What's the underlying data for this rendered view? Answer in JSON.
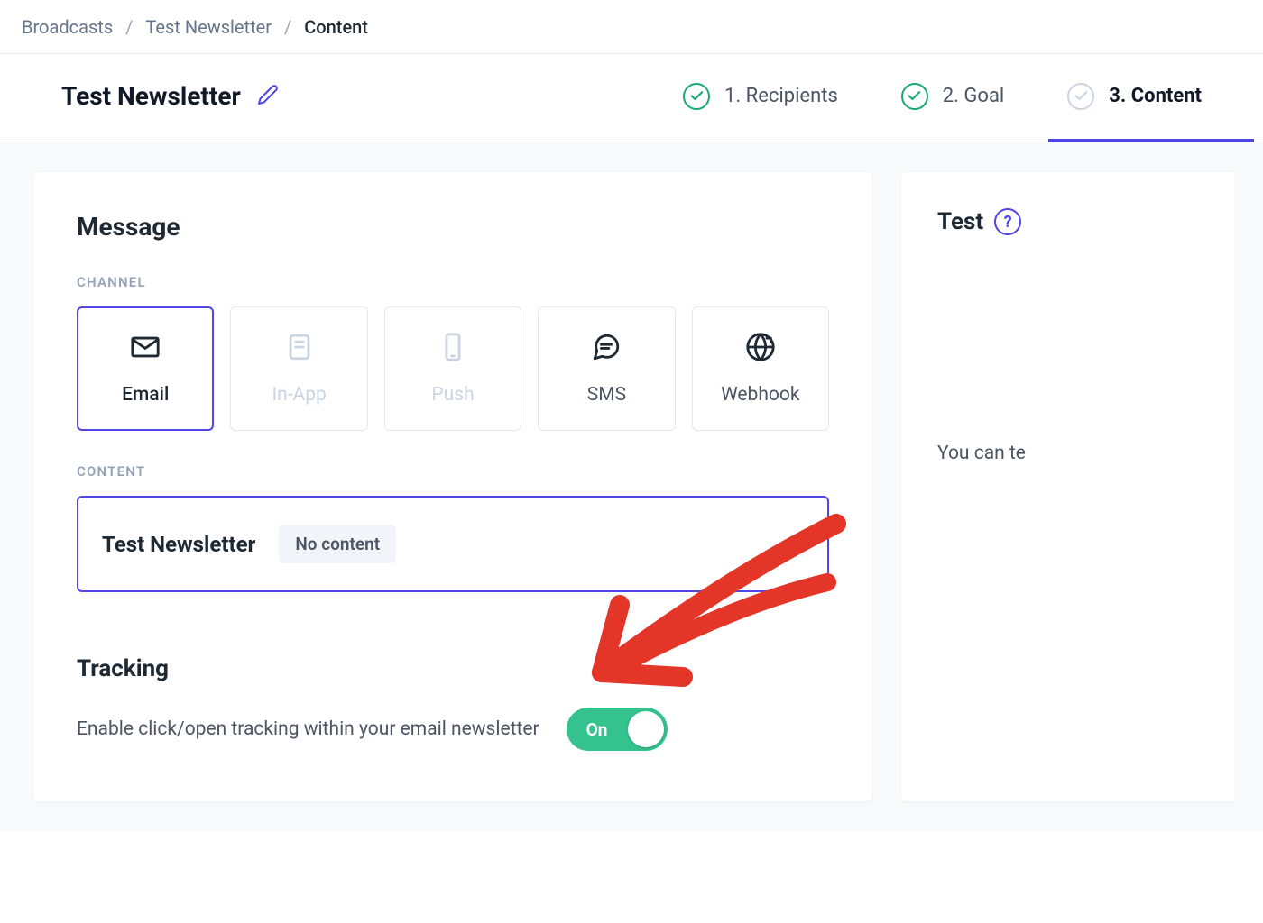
{
  "breadcrumb": {
    "root": "Broadcasts",
    "parent": "Test Newsletter",
    "current": "Content"
  },
  "header": {
    "title": "Test Newsletter"
  },
  "steps": {
    "s1": "1. Recipients",
    "s2": "2. Goal",
    "s3": "3. Content"
  },
  "message": {
    "section_title": "Message",
    "channel_label": "CHANNEL",
    "channels": {
      "email": "Email",
      "inapp": "In-App",
      "push": "Push",
      "sms": "SMS",
      "webhook": "Webhook"
    },
    "content_label": "CONTENT",
    "content_name": "Test Newsletter",
    "content_badge": "No content"
  },
  "tracking": {
    "title": "Tracking",
    "desc": "Enable click/open tracking within your email newsletter",
    "toggle_label": "On"
  },
  "side": {
    "title": "Test",
    "help": "?",
    "text": "You can te"
  }
}
